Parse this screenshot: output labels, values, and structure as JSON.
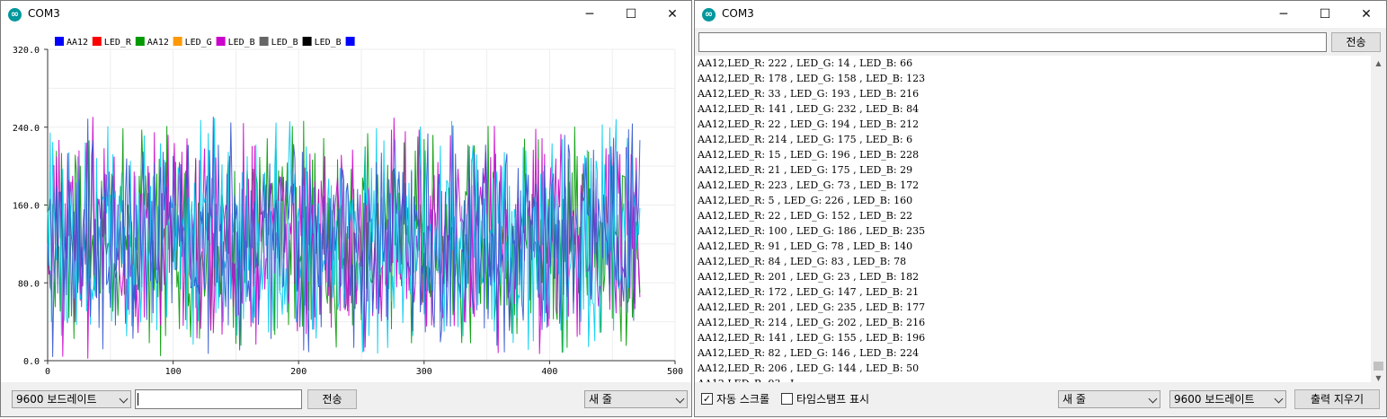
{
  "left_window": {
    "title": "COM3",
    "baud_select": "9600 보드레이트",
    "send_input_value": "",
    "send_button": "전송",
    "line_ending_select": "새 줄",
    "legend": [
      {
        "label": "AA12",
        "color": "#0000ff"
      },
      {
        "label": "LED_R",
        "color": "#ff0000"
      },
      {
        "label": "AA12",
        "color": "#009900"
      },
      {
        "label": "LED_G",
        "color": "#ff9900"
      },
      {
        "label": "LED_B",
        "color": "#cc00cc"
      },
      {
        "label": "LED_B",
        "color": "#666666"
      },
      {
        "label": "LED_B",
        "color": "#000000"
      },
      {
        "label": "",
        "color": "#0000ff"
      }
    ]
  },
  "right_window": {
    "title": "COM3",
    "send_input_value": "",
    "send_button": "전송",
    "autoscroll_label": "자동 스크롤",
    "autoscroll_checked": true,
    "timestamp_label": "타임스탬프 표시",
    "timestamp_checked": false,
    "line_ending_select": "새 줄",
    "baud_select": "9600 보드레이트",
    "clear_button": "출력 지우기",
    "serial_lines": [
      "AA12,LED_R: 222 , LED_G: 14 , LED_B: 66",
      "AA12,LED_R: 178 , LED_G: 158 , LED_B: 123",
      "AA12,LED_R: 33 , LED_G: 193 , LED_B: 216",
      "AA12,LED_R: 141 , LED_G: 232 , LED_B: 84",
      "AA12,LED_R: 22 , LED_G: 194 , LED_B: 212",
      "AA12,LED_R: 214 , LED_G: 175 , LED_B: 6",
      "AA12,LED_R: 15 , LED_G: 196 , LED_B: 228",
      "AA12,LED_R: 21 , LED_G: 175 , LED_B: 29",
      "AA12,LED_R: 223 , LED_G: 73 , LED_B: 172",
      "AA12,LED_R: 5 , LED_G: 226 , LED_B: 160",
      "AA12,LED_R: 22 , LED_G: 152 , LED_B: 22",
      "AA12,LED_R: 100 , LED_G: 186 , LED_B: 235",
      "AA12,LED_R: 91 , LED_G: 78 , LED_B: 140",
      "AA12,LED_R: 84 , LED_G: 83 , LED_B: 78",
      "AA12,LED_R: 201 , LED_G: 23 , LED_B: 182",
      "AA12,LED_R: 172 , LED_G: 147 , LED_B: 21",
      "AA12,LED_R: 201 , LED_G: 235 , LED_B: 177",
      "AA12,LED_R: 214 , LED_G: 202 , LED_B: 216",
      "AA12,LED_R: 141 , LED_G: 155 , LED_B: 196",
      "AA12,LED_R: 82 , LED_G: 146 , LED_B: 224",
      "AA12,LED_R: 206 , LED_G: 144 , LED_B: 50",
      "AA12,LED_R: 93 , L"
    ]
  },
  "window_controls": {
    "minimize": "─",
    "maximize": "☐",
    "close": "✕"
  },
  "chart_data": {
    "type": "line",
    "title": "",
    "xlabel": "",
    "ylabel": "",
    "xlim": [
      0,
      500
    ],
    "ylim": [
      0,
      320
    ],
    "x_ticks": [
      "0",
      "100",
      "200",
      "300",
      "400",
      "500"
    ],
    "y_ticks": [
      "0.0",
      "80.0",
      "160.0",
      "240.0",
      "320.0"
    ],
    "grid": true,
    "legend_position": "top",
    "x_end": 472,
    "series_colors": {
      "LED_G": "#009900",
      "LED_B": "#cc00cc",
      "LED_B_2": "#00ccee",
      "AA12": "#3355cc"
    },
    "sample_values_note_free": true,
    "series": [
      {
        "name": "LED_G",
        "values": [
          230,
          40,
          160,
          90,
          250,
          20,
          120,
          200,
          60,
          140,
          10,
          240,
          80,
          180,
          30,
          220,
          110,
          50,
          190,
          130
        ]
      },
      {
        "name": "LED_B",
        "values": [
          120,
          210,
          30,
          170,
          70,
          240,
          15,
          150,
          100,
          230,
          45,
          190,
          5,
          130,
          210,
          60,
          250,
          90,
          160,
          20
        ]
      },
      {
        "name": "LED_B",
        "values": [
          60,
          150,
          240,
          20,
          200,
          110,
          170,
          40,
          230,
          80,
          180,
          10,
          140,
          250,
          50,
          120,
          30,
          220,
          100,
          190
        ]
      },
      {
        "name": "AA12",
        "values": [
          190,
          80,
          130,
          220,
          10,
          160,
          230,
          100,
          20,
          180,
          120,
          60,
          250,
          30,
          90,
          170,
          200,
          140,
          40,
          110
        ]
      }
    ]
  }
}
